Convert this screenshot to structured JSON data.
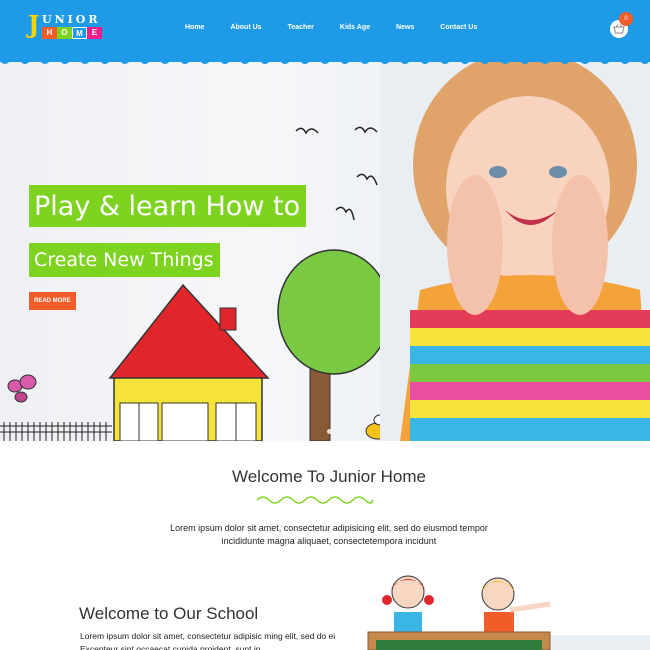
{
  "brand": {
    "logo_top": "UNIOR",
    "logo_j": "J",
    "logo_blocks": [
      "H",
      "O",
      "M",
      "E"
    ],
    "block_colors": [
      "#f25c28",
      "#7ed321",
      "#1f9ae6",
      "#e91e8c"
    ]
  },
  "nav": {
    "items": [
      "Home",
      "About Us",
      "Teacher",
      "Kids Age",
      "News",
      "Contact Us"
    ]
  },
  "cart": {
    "count": "0",
    "icon": "basket-icon"
  },
  "hero": {
    "headline_line1": "Play & learn How to",
    "headline_line2": "Create New Things",
    "button_label": "READ MORE"
  },
  "welcome": {
    "title": "Welcome To Junior Home",
    "text": "Lorem ipsum dolor sit amet, consectetur adipisicing elit, sed do eiusmod tempor incididunte magna aliquaet, consectetempora incidunt"
  },
  "school": {
    "title": "Welcome to Our School",
    "text": "Lorem ipsum dolor sit amet, consectetur adipisic ming elit, sed do ei Excepteur sint occaecat cupida proident, sunt in"
  },
  "colors": {
    "header_blue": "#1f9ae6",
    "accent_green": "#7ed321",
    "accent_orange": "#f25c28"
  }
}
